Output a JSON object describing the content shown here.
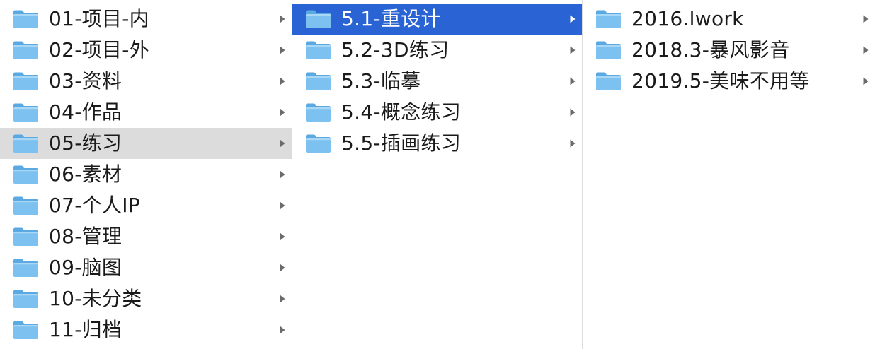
{
  "finder": {
    "column1": {
      "items": [
        {
          "label": "01-项目-内"
        },
        {
          "label": "02-项目-外"
        },
        {
          "label": "03-资料"
        },
        {
          "label": "04-作品"
        },
        {
          "label": "05-练习"
        },
        {
          "label": "06-素材"
        },
        {
          "label": "07-个人IP"
        },
        {
          "label": "08-管理"
        },
        {
          "label": "09-脑图"
        },
        {
          "label": "10-未分类"
        },
        {
          "label": "11-归档"
        }
      ]
    },
    "column2": {
      "items": [
        {
          "label": "5.1-重设计"
        },
        {
          "label": "5.2-3D练习"
        },
        {
          "label": "5.3-临摹"
        },
        {
          "label": "5.4-概念练习"
        },
        {
          "label": "5.5-插画练习"
        }
      ]
    },
    "column3": {
      "items": [
        {
          "label": "2016.lwork"
        },
        {
          "label": "2018.3-暴风影音"
        },
        {
          "label": "2019.5-美味不用等"
        }
      ]
    },
    "icons": {
      "folder": "folder-icon",
      "chevron": "chevron-right-icon"
    },
    "colors": {
      "active_selection": "#2a64d4",
      "inactive_selection": "#dcdcdc",
      "folder_body": "#7cc1ef",
      "folder_tab": "#5aa9e2",
      "chevron": "#6b6b6b",
      "chevron_active": "#ffffff"
    }
  }
}
